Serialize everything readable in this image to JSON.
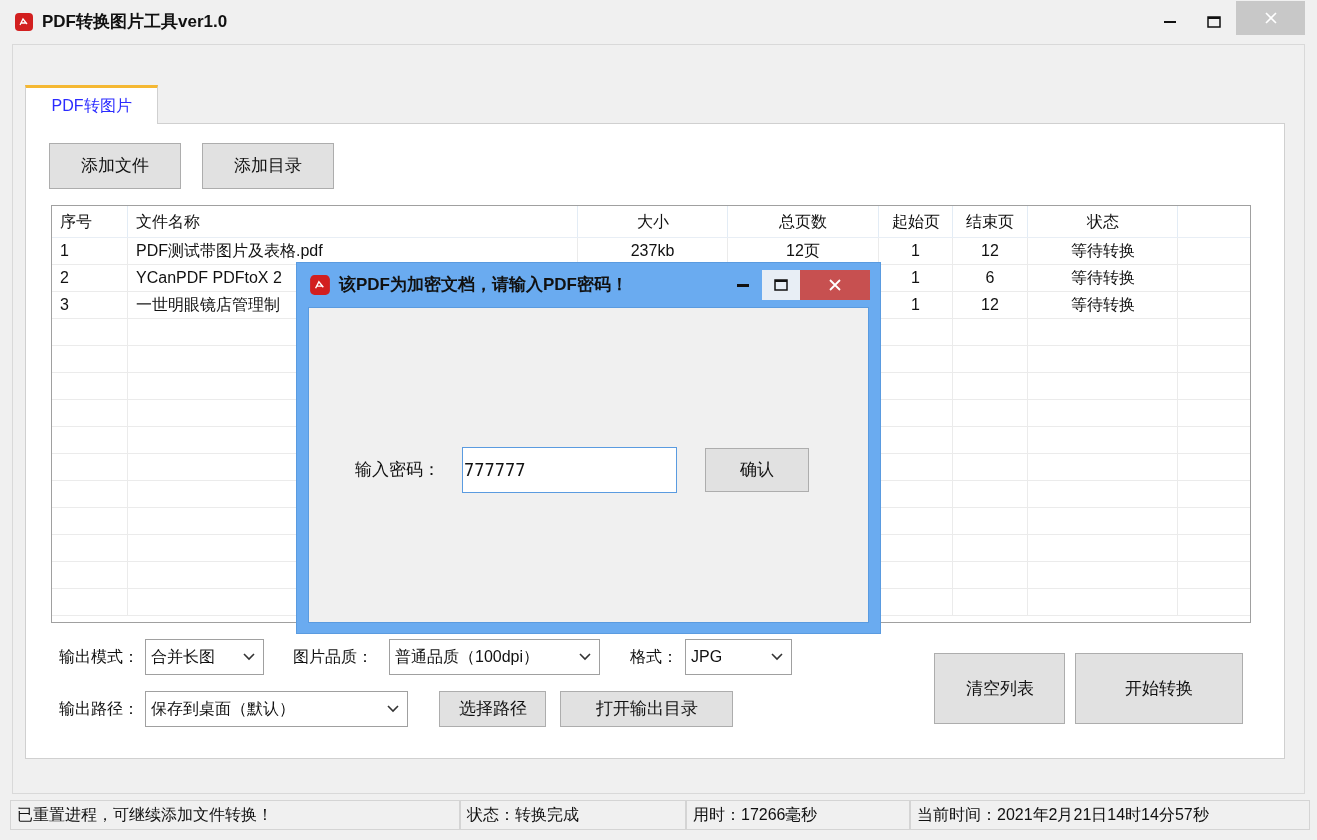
{
  "window": {
    "title": "PDF转换图片工具ver1.0"
  },
  "tabs": [
    {
      "label": "PDF转图片",
      "selected": true
    }
  ],
  "toolbar": [
    "添加文件",
    "添加目录"
  ],
  "table": {
    "columns": [
      "序号",
      "文件名称",
      "大小",
      "总页数",
      "起始页",
      "结束页",
      "状态"
    ],
    "rows": [
      {
        "index": "1",
        "name": "PDF测试带图片及表格.pdf",
        "size": "237kb",
        "pages": "12页",
        "start": "1",
        "end": "12",
        "status": "等待转换"
      },
      {
        "index": "2",
        "name": "YCanPDF PDFtoX 2",
        "start": "1",
        "end": "6",
        "status": "等待转换"
      },
      {
        "index": "3",
        "name": "一世明眼镜店管理制",
        "start": "1",
        "end": "12",
        "status": "等待转换"
      }
    ]
  },
  "options": {
    "mode_label": "输出模式：",
    "mode": "合并长图",
    "quality_label": "图片品质：",
    "quality": "普通品质（100dpi）",
    "format_label": "格式：",
    "format": "JPG",
    "path_label": "输出路径：",
    "path": "保存到桌面（默认）",
    "choose_path": "选择路径",
    "open_output": "打开输出目录"
  },
  "actions": [
    "清空列表",
    "开始转换"
  ],
  "status_bar": [
    "已重置进程，可继续添加文件转换！",
    "状态：转换完成",
    "用时：17266毫秒",
    "当前时间：2021年2月21日14时14分57秒"
  ],
  "dialog": {
    "title": "该PDF为加密文档，请输入PDF密码！",
    "label": "输入密码：",
    "value": "777777",
    "confirm": "确认"
  }
}
